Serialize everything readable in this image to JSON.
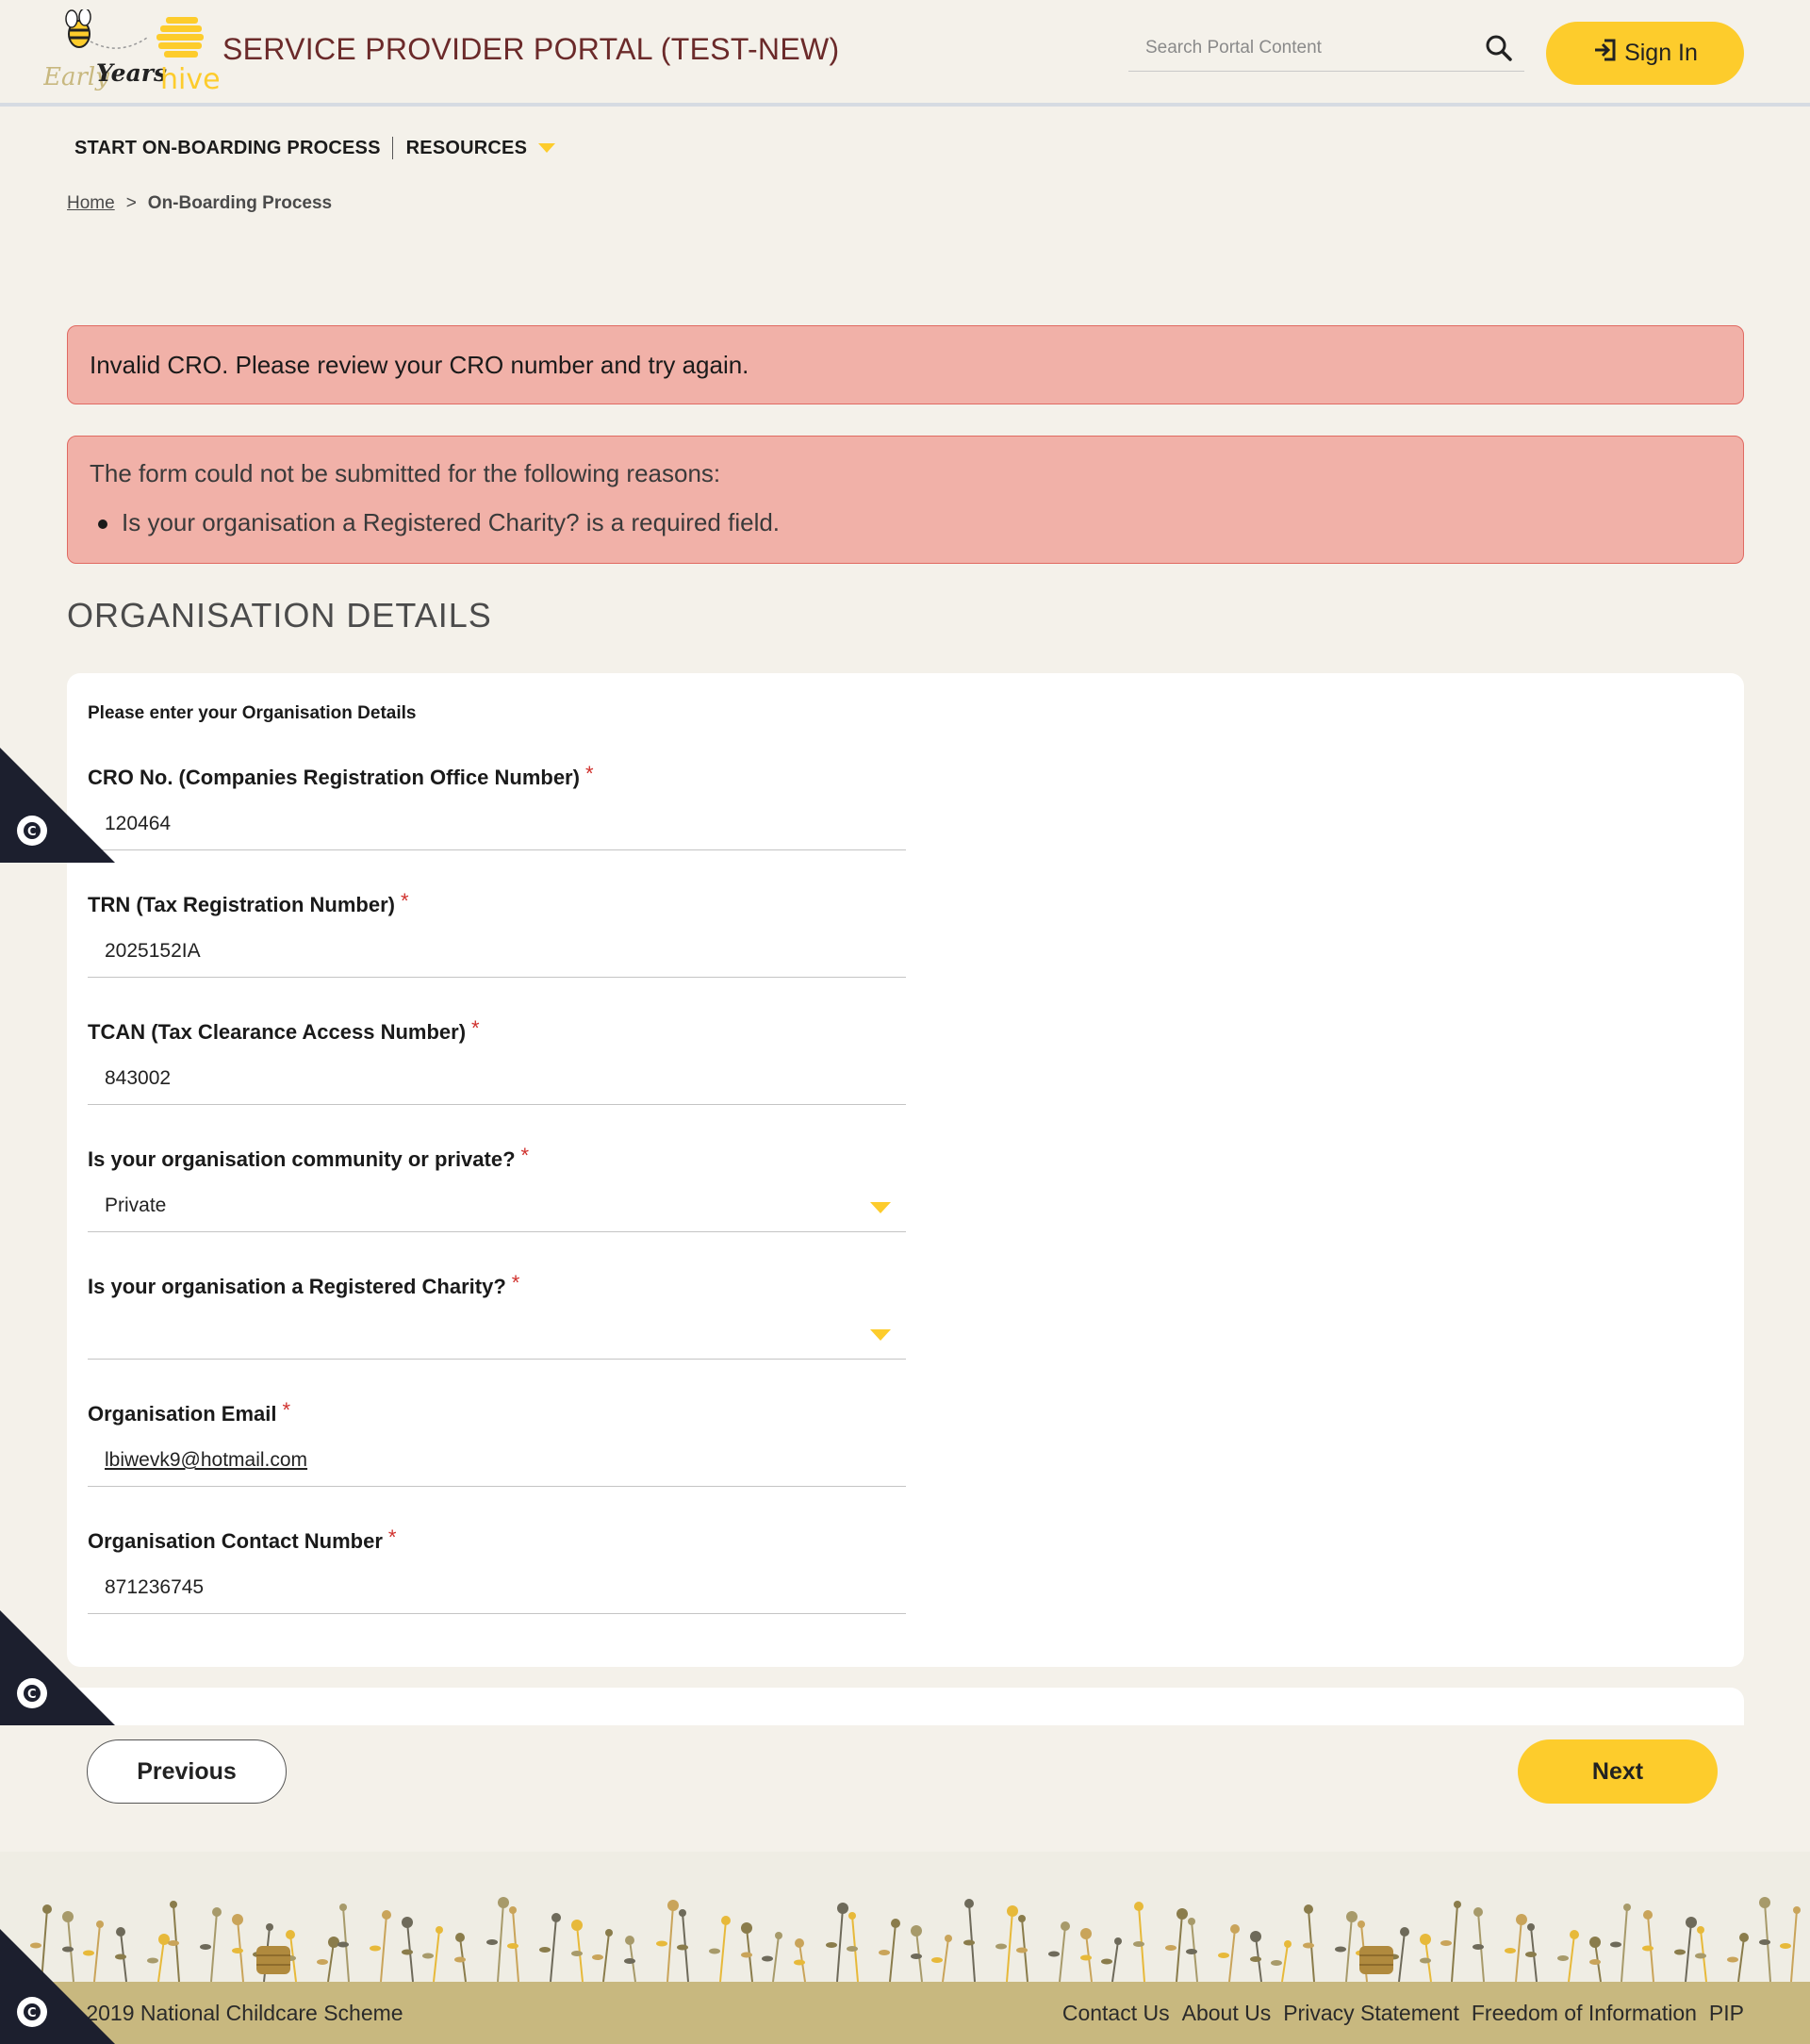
{
  "header": {
    "logo_alt": "Early Years hive",
    "portal_title": "SERVICE PROVIDER PORTAL (TEST-NEW)",
    "search_placeholder": "Search Portal Content",
    "signin_label": "Sign In"
  },
  "nav": {
    "items": [
      {
        "label": "START ON-BOARDING PROCESS"
      },
      {
        "label": "RESOURCES"
      }
    ]
  },
  "breadcrumb": {
    "home": "Home",
    "separator": ">",
    "current": "On-Boarding Process"
  },
  "alerts": {
    "cro_error": "Invalid CRO. Please review your CRO number and try again.",
    "form_error_title": "The form could not be submitted for the following reasons:",
    "form_errors": [
      "Is your organisation a Registered Charity? is a required field."
    ]
  },
  "section_title": "ORGANISATION DETAILS",
  "form": {
    "intro": "Please enter your Organisation Details",
    "required_marker": "*",
    "fields": [
      {
        "label": "CRO No. (Companies Registration Office Number)",
        "value": "120464"
      },
      {
        "label": "TRN (Tax Registration Number)",
        "value": "2025152IA"
      },
      {
        "label": "TCAN (Tax Clearance Access Number)",
        "value": "843002"
      },
      {
        "label": "Is your organisation community or private?",
        "value": "Private"
      },
      {
        "label": "Is your organisation a Registered Charity?",
        "value": ""
      },
      {
        "label": "Organisation Email",
        "value": "lbiwevk9@hotmail.com"
      },
      {
        "label": "Organisation Contact Number",
        "value": "871236745"
      }
    ]
  },
  "buttons": {
    "previous": "Previous",
    "next": "Next"
  },
  "footer": {
    "copyright": "© 2019 National Childcare Scheme",
    "links": [
      "Contact Us",
      "About Us",
      "Privacy Statement",
      "Freedom of Information",
      "PIP"
    ]
  },
  "colors": {
    "accent_yellow": "#fdcc2c",
    "title_maroon": "#6b2a2a",
    "error_bg": "#f1b1a8",
    "footer_bar": "#c8b87f"
  }
}
